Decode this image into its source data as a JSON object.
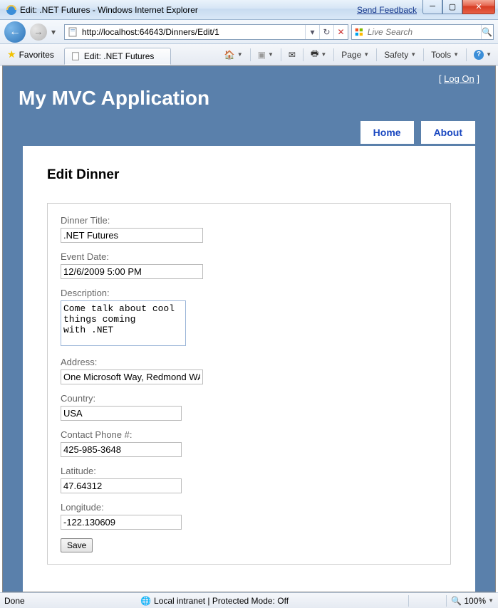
{
  "window": {
    "title": "Edit: .NET Futures - Windows Internet Explorer",
    "send_feedback": "Send Feedback"
  },
  "nav": {
    "url": "http://localhost:64643/Dinners/Edit/1",
    "search_placeholder": "Live Search"
  },
  "toolbar": {
    "favorites": "Favorites",
    "tab_label": "Edit: .NET Futures",
    "page": "Page",
    "safety": "Safety",
    "tools": "Tools"
  },
  "page": {
    "logon_prefix": "[ ",
    "logon": "Log On",
    "logon_suffix": " ]",
    "app_title": "My MVC Application",
    "tab_home": "Home",
    "tab_about": "About",
    "heading": "Edit Dinner",
    "fields": {
      "title_label": "Dinner Title:",
      "title_value": ".NET Futures",
      "date_label": "Event Date:",
      "date_value": "12/6/2009 5:00 PM",
      "desc_label": "Description:",
      "desc_value": "Come talk about cool\nthings coming\nwith .NET",
      "addr_label": "Address:",
      "addr_value": "One Microsoft Way, Redmond WA",
      "country_label": "Country:",
      "country_value": "USA",
      "phone_label": "Contact Phone #:",
      "phone_value": "425-985-3648",
      "lat_label": "Latitude:",
      "lat_value": "47.64312",
      "lon_label": "Longitude:",
      "lon_value": "-122.130609"
    },
    "save": "Save"
  },
  "status": {
    "left": "Done",
    "zone": "Local intranet | Protected Mode: Off",
    "zoom": "100%"
  }
}
